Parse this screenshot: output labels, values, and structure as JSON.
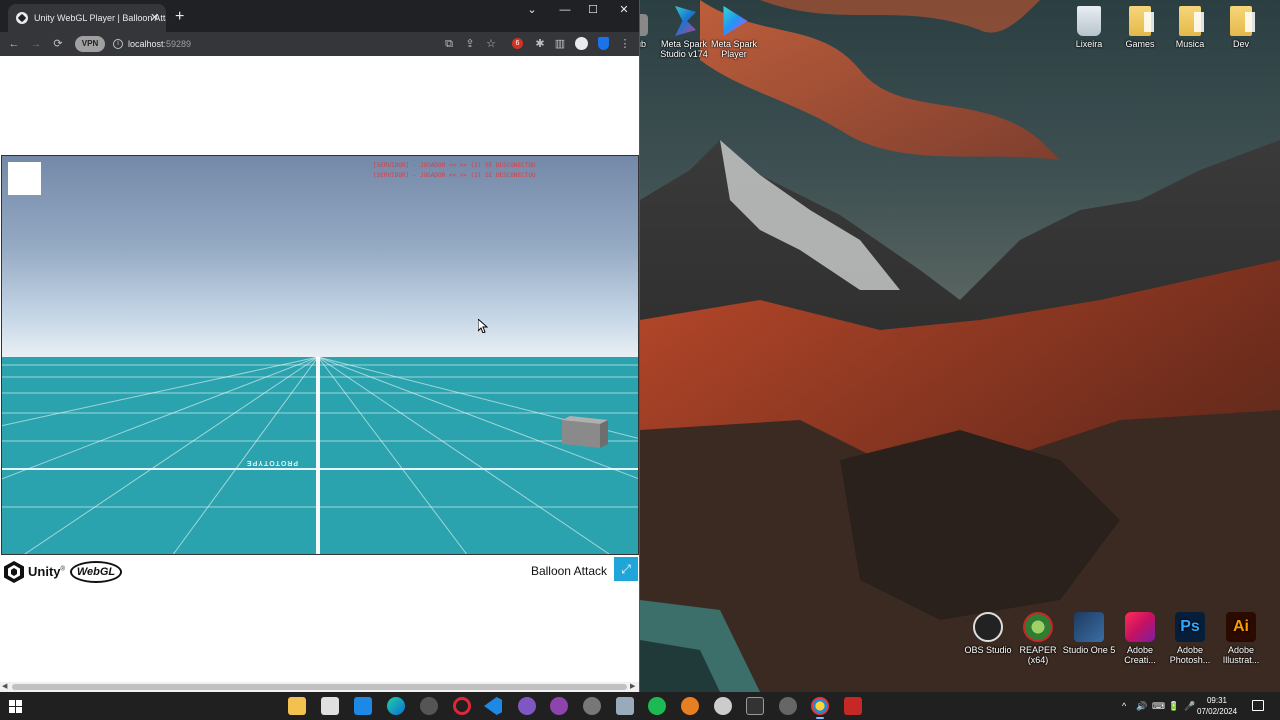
{
  "browser": {
    "tab_title": "Unity WebGL Player | Balloon Attack",
    "tab_close": "✕",
    "new_tab": "+",
    "window_controls": {
      "dropdown": "⌄",
      "minimize": "—",
      "maximize": "☐",
      "close": "✕"
    },
    "toolbar": {
      "back": "←",
      "forward": "→",
      "reload": "⟳",
      "vpn_label": "VPN",
      "info": "i",
      "url_host": "localhost",
      "url_port": ":59289",
      "translate": "⧉",
      "share": "⇪",
      "bookmark": "☆",
      "ext_badge": "6",
      "extensions": "✱",
      "sidepanel": "▥",
      "menu": "⋮"
    }
  },
  "game": {
    "log_lines": [
      "[SERVIDOR] - JOGADOR << >> (2) SE DESCONECTOU",
      "[SERVIDOR] - JOGADOR << >> (2) SE DESCONECTOU"
    ],
    "ground_labels": [
      "PROTOTYPE"
    ],
    "colors": {
      "sky_top": "#7489a8",
      "sky_horizon": "#e8f0f4",
      "ground": "#2aa3ae",
      "log_text": "#d7404a"
    }
  },
  "footer": {
    "unity_label": "Unity",
    "unity_tm": "®",
    "webgl_label": "WebGL",
    "game_title": "Balloon Attack",
    "fullscreen_icon": "⤢"
  },
  "scrollbar": {
    "left_arrow": "◀",
    "right_arrow": "▶"
  },
  "desktop": {
    "icons_top": [
      {
        "label": "Meta Spark Studio v174",
        "icon": "meta-spark-studio-icon"
      },
      {
        "label": "Meta Spark Player",
        "icon": "meta-spark-player-icon"
      },
      {
        "label": "Lixeira",
        "icon": "recycle-bin-icon"
      },
      {
        "label": "Games",
        "icon": "folder-icon"
      },
      {
        "label": "Musica",
        "icon": "folder-icon"
      },
      {
        "label": "Dev",
        "icon": "folder-icon"
      }
    ],
    "partial_label": "ub",
    "icons_bottom": [
      {
        "label": "OBS Studio",
        "icon": "obs-icon"
      },
      {
        "label": "REAPER (x64)",
        "icon": "reaper-icon"
      },
      {
        "label": "Studio One 5",
        "icon": "studio-one-icon"
      },
      {
        "label": "Adobe Creati...",
        "icon": "creative-cloud-icon"
      },
      {
        "label": "Adobe Photosh...",
        "icon": "photoshop-icon",
        "glyph": "Ps"
      },
      {
        "label": "Adobe Illustrat...",
        "icon": "illustrator-icon",
        "glyph": "Ai"
      }
    ]
  },
  "taskbar": {
    "clock_time": "09:31",
    "clock_date": "07/02/2024",
    "tray_chevron": "^",
    "tray_icons": [
      "🔊",
      "⌨",
      "🔋",
      "🎤"
    ]
  }
}
